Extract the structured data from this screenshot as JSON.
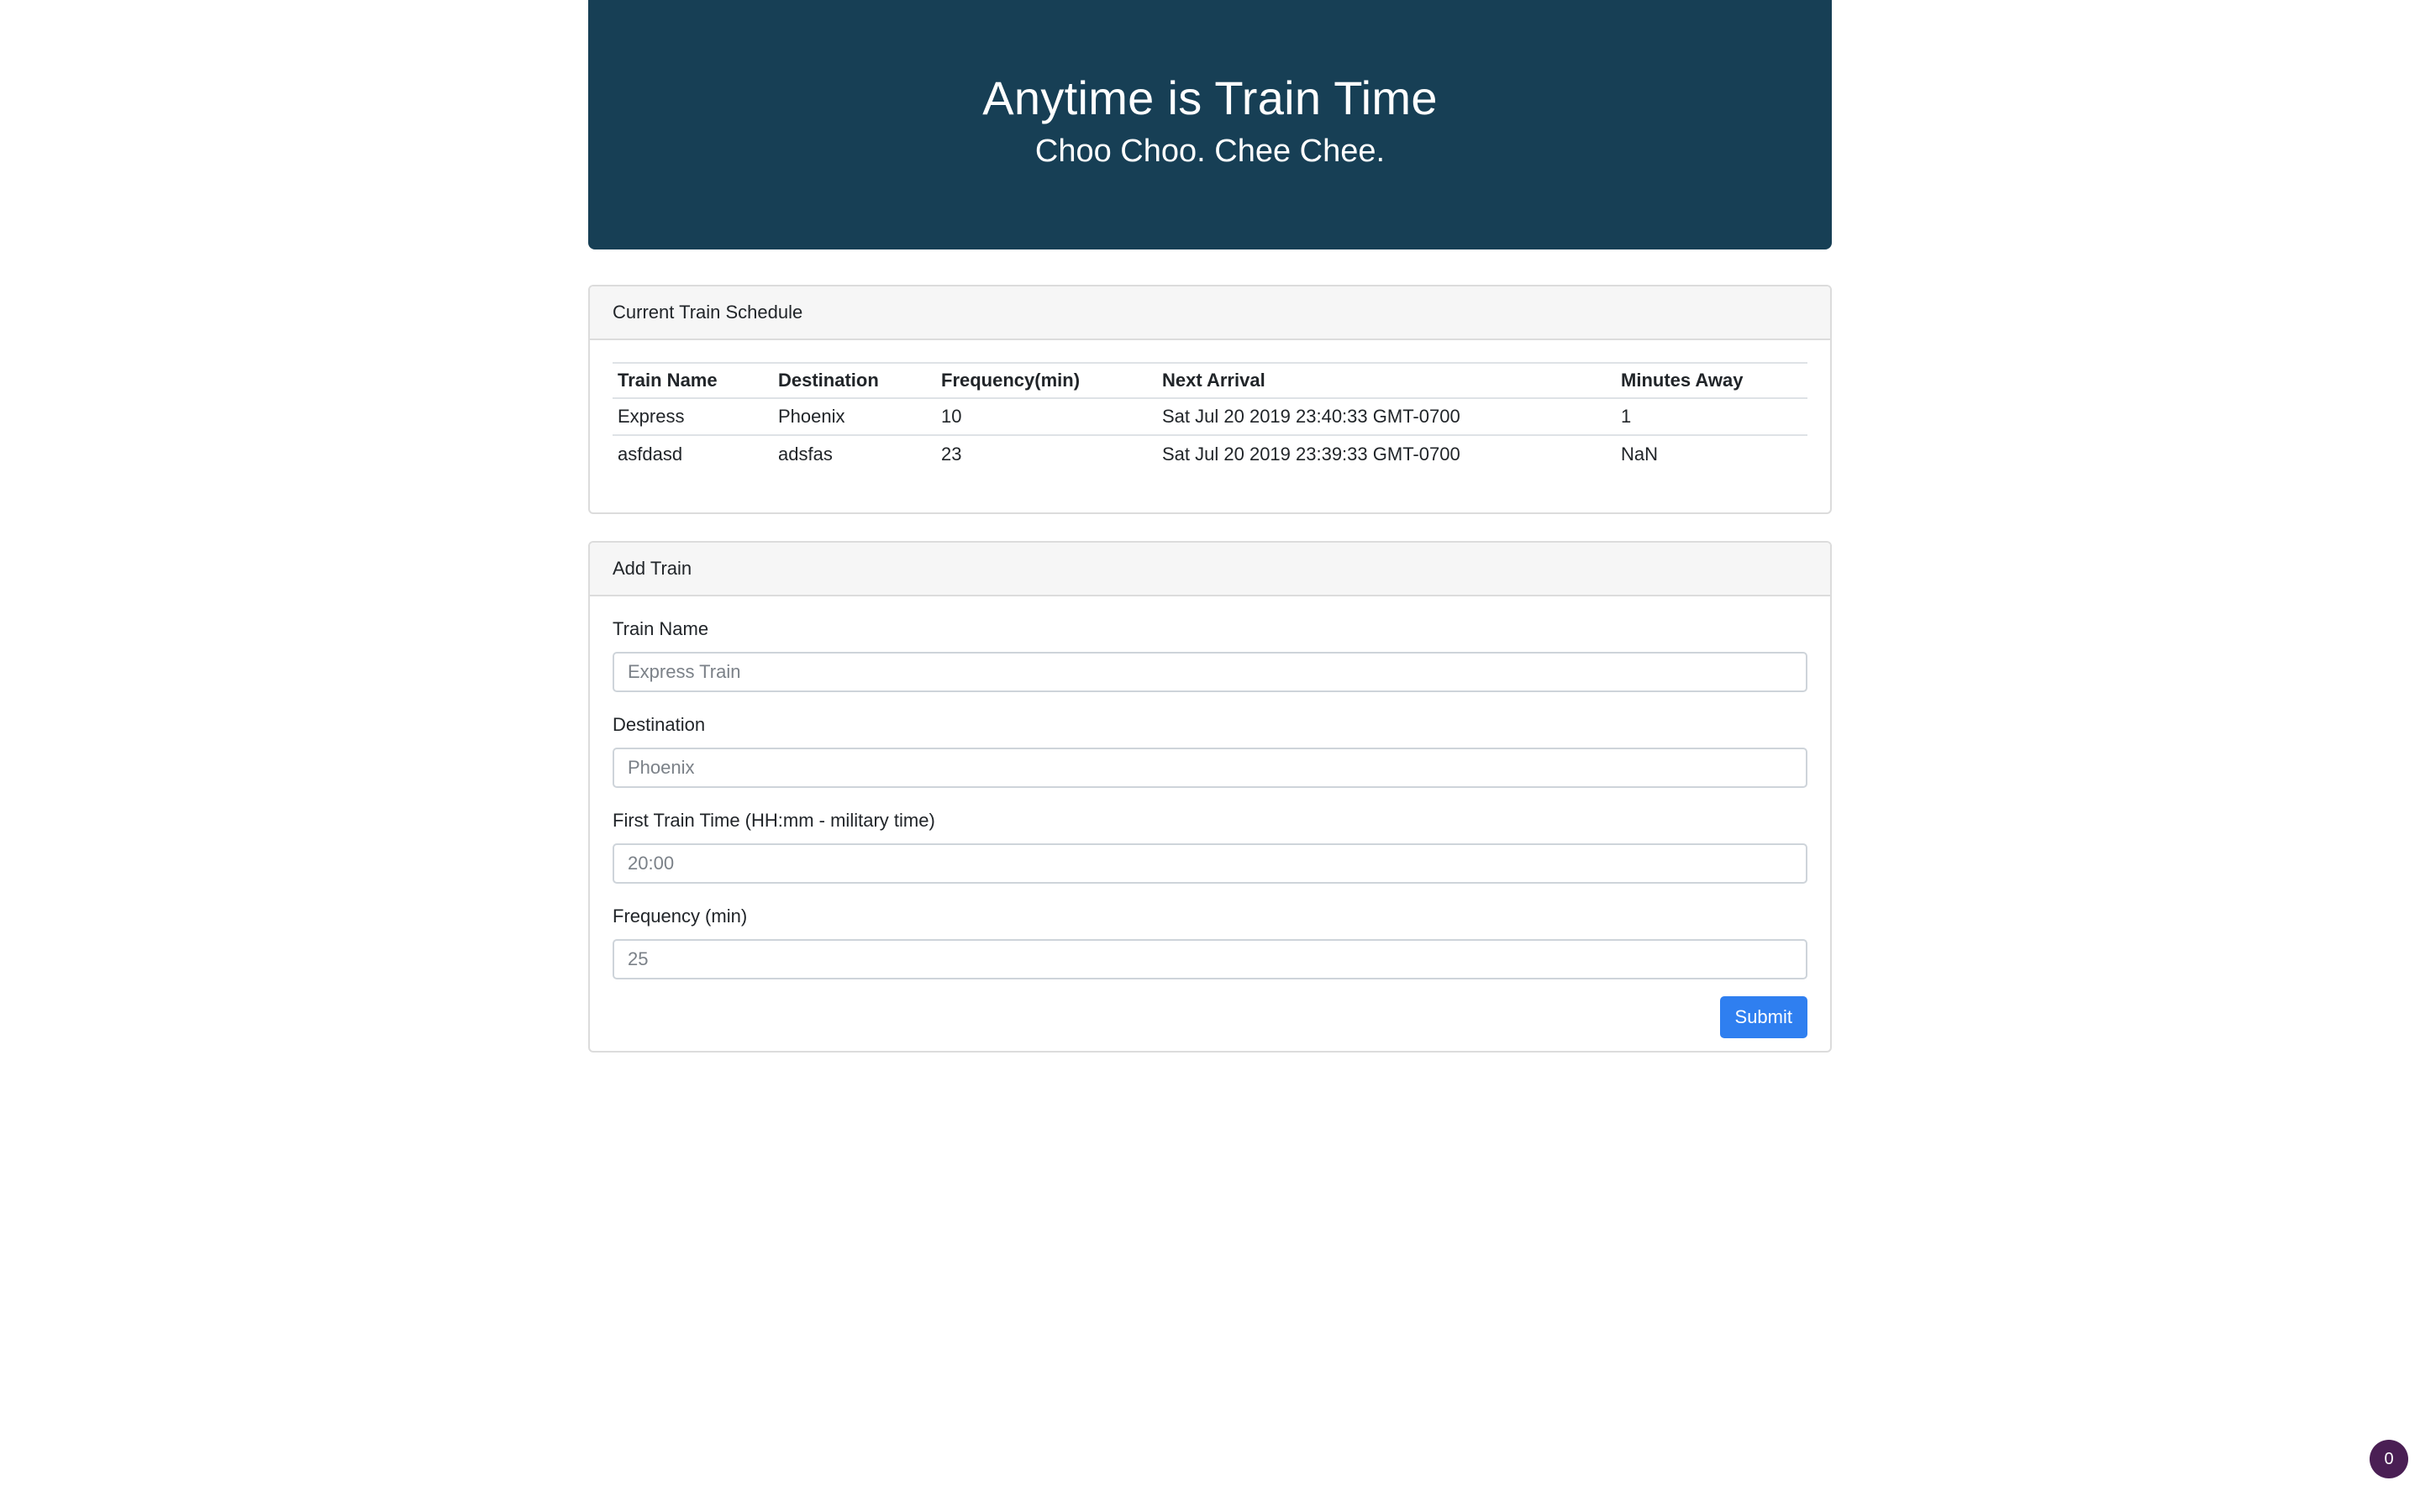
{
  "header": {
    "title": "Anytime is Train Time",
    "subtitle": "Choo Choo. Chee Chee."
  },
  "schedule": {
    "heading": "Current Train Schedule",
    "columns": [
      "Train Name",
      "Destination",
      "Frequency(min)",
      "Next Arrival",
      "Minutes Away"
    ],
    "rows": [
      [
        "Express",
        "Phoenix",
        "10",
        "Sat Jul 20 2019 23:40:33 GMT-0700",
        "1"
      ],
      [
        "asfdasd",
        "adsfas",
        "23",
        "Sat Jul 20 2019 23:39:33 GMT-0700",
        "NaN"
      ]
    ]
  },
  "add_train": {
    "heading": "Add Train",
    "fields": [
      {
        "label": "Train Name",
        "placeholder": "Express Train",
        "value": ""
      },
      {
        "label": "Destination",
        "placeholder": "Phoenix",
        "value": ""
      },
      {
        "label": "First Train Time (HH:mm - military time)",
        "placeholder": "20:00",
        "value": ""
      },
      {
        "label": "Frequency (min)",
        "placeholder": "25",
        "value": ""
      }
    ],
    "submit_label": "Submit"
  },
  "corner_badge": {
    "count": "0"
  },
  "colors": {
    "header_bg": "#173f55",
    "submit_bg": "#2f7ff0",
    "badge_bg": "#4a1f54"
  }
}
